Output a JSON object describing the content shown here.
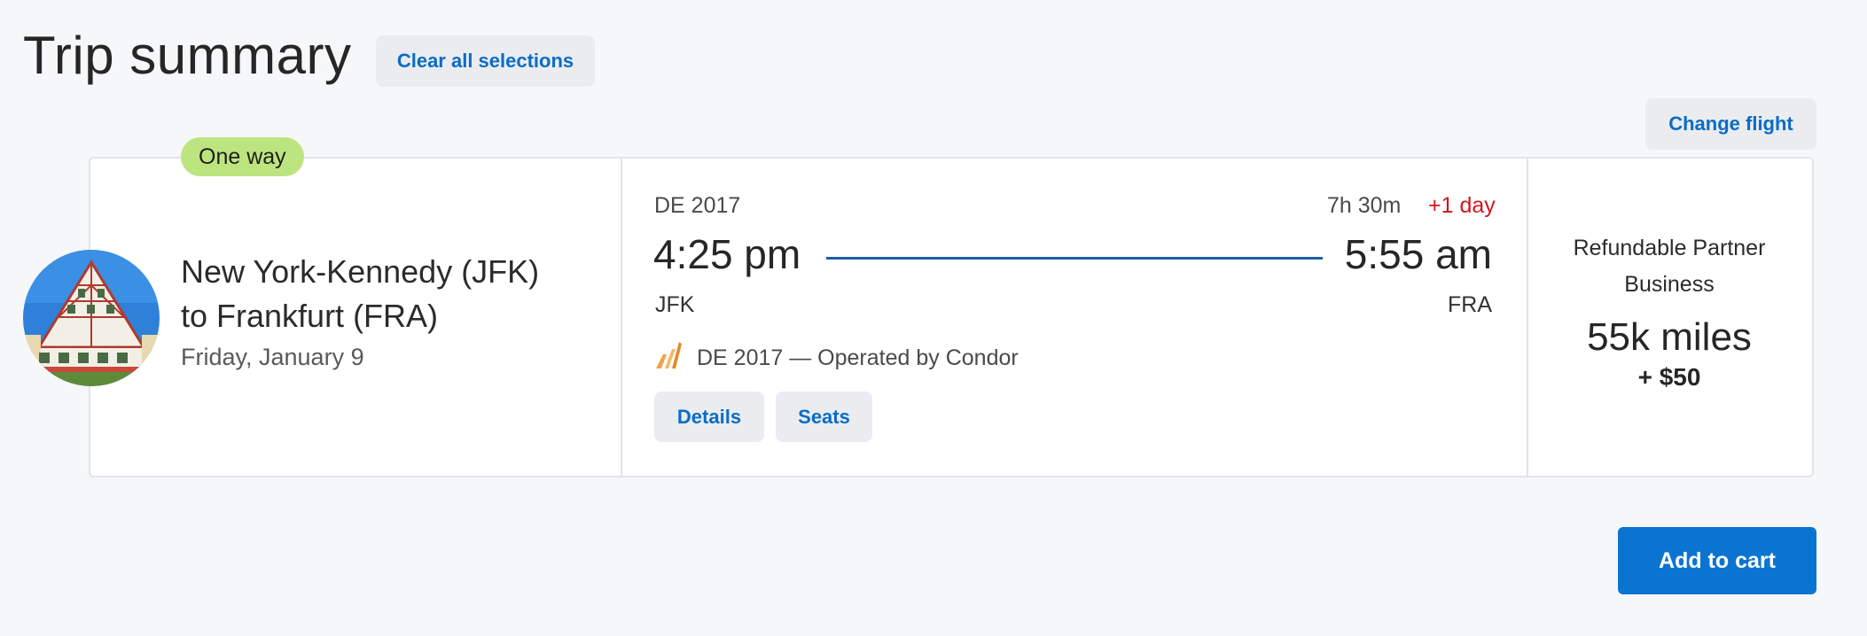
{
  "header": {
    "title": "Trip summary",
    "clear_label": "Clear all selections",
    "change_flight_label": "Change flight"
  },
  "trip": {
    "badge": "One way",
    "route_line1": "New York-Kennedy (JFK)",
    "route_line2": "to Frankfurt (FRA)",
    "date": "Friday, January 9",
    "destination_image": "half-timbered house photo"
  },
  "flight": {
    "number": "DE 2017",
    "duration": "7h 30m",
    "day_offset": "+1 day",
    "departure_time": "4:25 pm",
    "arrival_time": "5:55 am",
    "origin": "JFK",
    "destination": "FRA",
    "operated_by": "DE 2017 — Operated by Condor",
    "airline_icon": "condor-logo-icon",
    "details_label": "Details",
    "seats_label": "Seats"
  },
  "fare": {
    "name_line1": "Refundable Partner",
    "name_line2": "Business",
    "miles": "55k miles",
    "cash": "+ $50"
  },
  "actions": {
    "add_to_cart_label": "Add to cart"
  },
  "colors": {
    "accent": "#0b74d0",
    "link": "#0a6cc5",
    "badge": "#bde57f",
    "warning": "#d0171d"
  }
}
